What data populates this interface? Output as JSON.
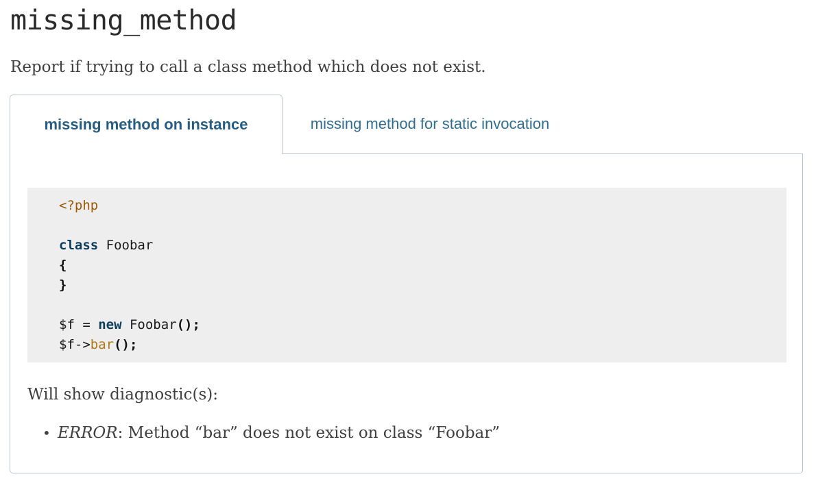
{
  "rule": {
    "name": "missing_method",
    "description": "Report if trying to call a class method which does not exist."
  },
  "tabs": [
    {
      "label": "missing method on instance",
      "active": true
    },
    {
      "label": "missing method for static invocation",
      "active": false
    }
  ],
  "example": {
    "code": {
      "open_tag": "<?php",
      "kw_class": "class",
      "class_name": " Foobar",
      "brace_open": "{",
      "brace_close": "}",
      "var_f": "$f = ",
      "kw_new": "new",
      "new_target": " Foobar",
      "call_parens": "();",
      "var_arrow": "$f->",
      "method_name": "bar",
      "call_parens_2": "();"
    },
    "diagnostics_label": "Will show diagnostic(s):",
    "diagnostics": [
      {
        "severity": "ERROR",
        "message": ": Method “bar” does not exist on class “Foobar”"
      }
    ]
  }
}
